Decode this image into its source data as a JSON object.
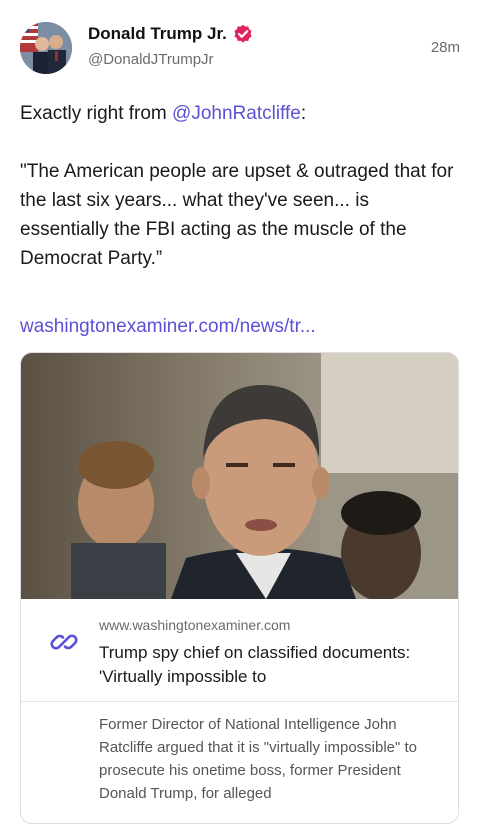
{
  "author": {
    "display_name": "Donald Trump Jr.",
    "handle": "@DonaldJTrumpJr",
    "verified_color": "#e0245e"
  },
  "post": {
    "timestamp": "28m",
    "intro": "Exactly right from ",
    "mention": "@JohnRatcliffe",
    "intro_end": ":",
    "quote": "\"The American people are upset & outraged that for the last six years... what they've seen... is essentially the FBI acting as the muscle of the Democrat Party.”",
    "link": "washingtonexaminer.com/news/tr..."
  },
  "link_card": {
    "domain": "www.washingtonexaminer.com",
    "title": "Trump spy chief on classified documents: 'Virtually impossible to",
    "description": "Former Director of National Intelligence John Ratcliffe argued that it is \"virtually impossible\" to prosecute his onetime boss, former President Donald Trump, for alleged",
    "icon": "link-icon",
    "accent_color": "#5b50d6"
  }
}
